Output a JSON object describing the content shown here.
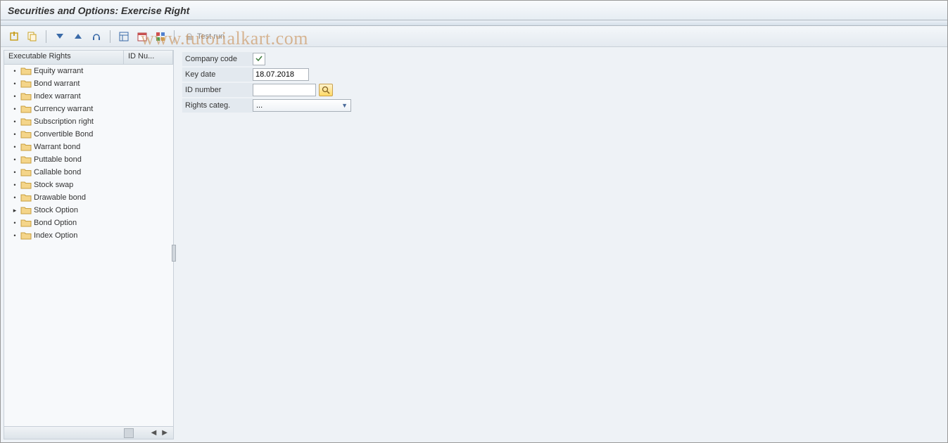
{
  "title": "Securities and Options: Exercise Right",
  "toolbar": {
    "test_run_label": "Test run"
  },
  "tree": {
    "header_col1": "Executable Rights",
    "header_col2": "ID Nu...",
    "items": [
      {
        "label": "Equity warrant",
        "bullet": "•"
      },
      {
        "label": "Bond warrant",
        "bullet": "•"
      },
      {
        "label": "Index warrant",
        "bullet": "•"
      },
      {
        "label": "Currency warrant",
        "bullet": "•"
      },
      {
        "label": "Subscription right",
        "bullet": "•"
      },
      {
        "label": "Convertible Bond",
        "bullet": "•"
      },
      {
        "label": "Warrant bond",
        "bullet": "•"
      },
      {
        "label": "Puttable bond",
        "bullet": "•"
      },
      {
        "label": "Callable bond",
        "bullet": "•"
      },
      {
        "label": "Stock swap",
        "bullet": "•"
      },
      {
        "label": "Drawable bond",
        "bullet": "•"
      },
      {
        "label": "Stock Option",
        "bullet": "▸"
      },
      {
        "label": "Bond Option",
        "bullet": "•"
      },
      {
        "label": "Index Option",
        "bullet": "•"
      }
    ]
  },
  "form": {
    "company_code_label": "Company code",
    "company_code_value": "",
    "key_date_label": "Key date",
    "key_date_value": "18.07.2018",
    "id_number_label": "ID number",
    "id_number_value": "",
    "rights_categ_label": "Rights categ.",
    "rights_categ_value": "..."
  },
  "watermark": "www.tutorialkart.com"
}
